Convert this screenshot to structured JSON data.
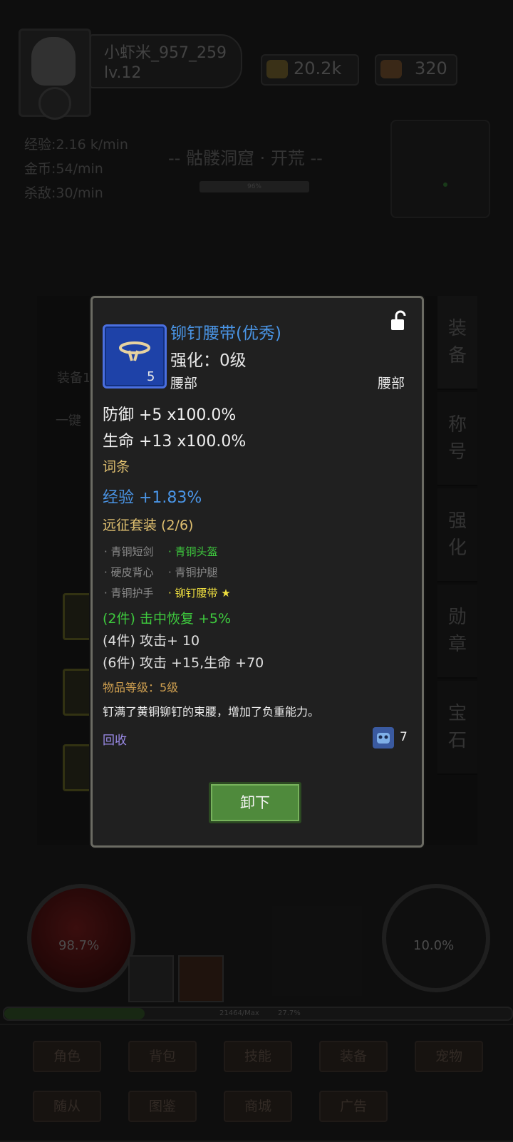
{
  "player": {
    "name": "小虾米_957_259",
    "level": "lv.12",
    "gold": "20.2k",
    "wood": "320"
  },
  "stats": {
    "exp_rate": "经验:2.16 k/min",
    "gold_rate": "金币:54/min",
    "kill_rate": "杀敌:30/min"
  },
  "zone": {
    "title": "-- 骷髅洞窟 · 开荒 --",
    "progress": "96%",
    "progress_value": 0.96
  },
  "background_panel": {
    "tab_label": "装备1",
    "onekey_label": "一键"
  },
  "side_tabs": [
    {
      "l1": "装",
      "l2": "备"
    },
    {
      "l1": "称",
      "l2": "号"
    },
    {
      "l1": "强",
      "l2": "化"
    },
    {
      "l1": "勋",
      "l2": "章"
    },
    {
      "l1": "宝",
      "l2": "石"
    }
  ],
  "item": {
    "name": "铆钉腰带(优秀)",
    "enhance": "强化：0级",
    "slot_left": "腰部",
    "slot_right": "腰部",
    "icon_level": "5",
    "defense": "防御 +5  x100.0%",
    "hp": "生命 +13  x100.0%",
    "affix_title": "词条",
    "affix_exp": "经验 +1.83%",
    "set_title": "远征套装 (2/6)",
    "set_items": [
      {
        "label": "· 青铜短剑",
        "state": "missing"
      },
      {
        "label": "· 青铜头盔",
        "state": "owned"
      },
      {
        "label": "· 硬皮背心",
        "state": "missing"
      },
      {
        "label": "· 青铜护腿",
        "state": "missing"
      },
      {
        "label": "· 青铜护手",
        "state": "missing"
      },
      {
        "label": "· 铆钉腰带 ★",
        "state": "current"
      }
    ],
    "set_bonus_2": "(2件) 击中恢复 +5%",
    "set_bonus_4": "(4件) 攻击+ 10",
    "set_bonus_6": "(6件) 攻击 +15,生命 +70",
    "item_level": "物品等级：5级",
    "description": "钉满了黄铜铆钉的束腰，增加了负重能力。",
    "recycle": "回收",
    "recycle_count": "7",
    "unequip": "卸下"
  },
  "hud": {
    "hp_percent": "98.7%",
    "mp_percent": "10.0%",
    "xp_text": "21464/Max",
    "xp_percent": "27.7%",
    "xp_value": 0.277
  },
  "nav": {
    "row1": [
      "角色",
      "背包",
      "技能",
      "装备",
      "宠物"
    ],
    "row2": [
      "随从",
      "图鉴",
      "商城",
      "广告"
    ]
  },
  "colors": {
    "item_name": "#4a95e6",
    "owned": "#3ecb3e",
    "current": "#f0e040",
    "gold_text": "#e0c070",
    "unequip_bg": "#4f8a3c"
  }
}
